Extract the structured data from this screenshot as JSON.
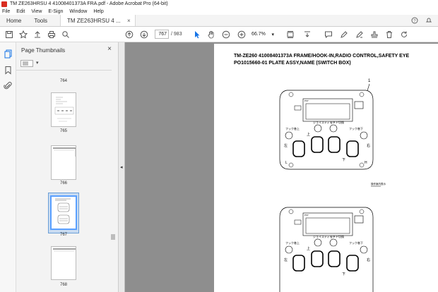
{
  "window": {
    "title": "TM ZE263HRSU 4 41008401373A FRA.pdf - Adobe Acrobat Pro (64-bit)"
  },
  "menu": [
    "File",
    "Edit",
    "View",
    "E-Sign",
    "Window",
    "Help"
  ],
  "tabs": {
    "home": "Home",
    "tools": "Tools",
    "document": "TM ZE263HRSU 4 ...",
    "close": "×"
  },
  "toolbar": {
    "current_page": "767",
    "page_separator": "/",
    "total_pages": "983",
    "zoom": "66.7%"
  },
  "panel": {
    "title": "Page Thumbnails",
    "close": "×",
    "thumbnails": [
      {
        "label": "764"
      },
      {
        "label": "765"
      },
      {
        "label": "766"
      },
      {
        "label": "767",
        "selected": true
      },
      {
        "label": "768"
      }
    ]
  },
  "splitter": {
    "arrow": "◂"
  },
  "document": {
    "heading_line1": "TM-ZE260 41008401373A FRAME/HOOK-IN,RADIO CONTROL,SAFETY EYE",
    "heading_line2": "PO1015660-01 PLATE ASSY,NAME (SWITCH BOX)",
    "callout_1": "1",
    "callout_2": "2",
    "panel_labels": {
      "top": "PST",
      "mid_left": "フック巻上",
      "mid_center_a": "ジョイスティック",
      "mid_center_b": "モード切換",
      "mid_right": "フック巻下",
      "left": "左",
      "up": "上",
      "right": "右",
      "down": "下",
      "lo": "L",
      "hi": "H"
    },
    "note_small": "操作案内表示"
  },
  "colors": {
    "accent": "#1473e6",
    "viewer_bg": "#8e8e8e",
    "selection": "#c9dcf2"
  }
}
